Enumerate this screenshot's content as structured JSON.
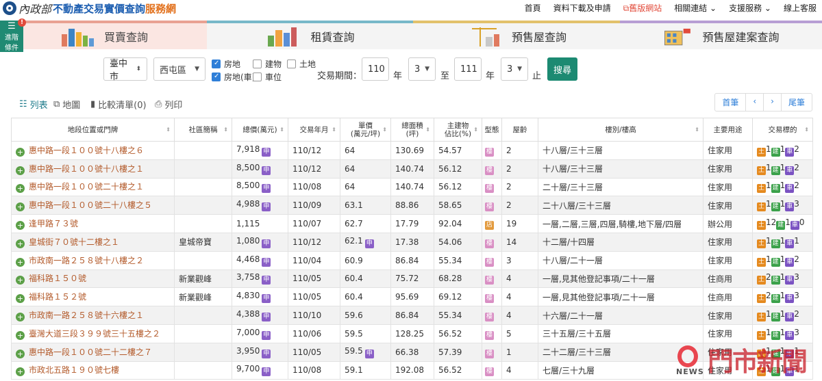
{
  "header": {
    "ministry": "內政部",
    "title_main": "不動產交易實價查詢",
    "title_sub": "服務網",
    "nav": [
      "首頁",
      "資料下載及申請",
      "舊版網站",
      "相關連結",
      "支援服務",
      "線上客服"
    ]
  },
  "advanced": {
    "label_1": "進階",
    "label_2": "條件",
    "badge": "!"
  },
  "tabs": [
    "買賣查詢",
    "租賃查詢",
    "預售屋查詢",
    "預售屋建案查詢"
  ],
  "search": {
    "city": "臺中市",
    "district": "西屯區",
    "checks": [
      {
        "label": "房地",
        "checked": true
      },
      {
        "label": "建物",
        "checked": false
      },
      {
        "label": "土地",
        "checked": false
      },
      {
        "label": "房地(車)",
        "checked": true
      },
      {
        "label": "車位",
        "checked": false
      }
    ],
    "period_label": "交易期間：",
    "from_year": "110",
    "from_month": "3",
    "to_label": "至",
    "to_year": "111",
    "to_month": "3",
    "year_unit": "年",
    "end_label": "止",
    "button": "搜尋"
  },
  "toolbar": {
    "list": "列表",
    "map": "地圖",
    "compare": "比較清單(0)",
    "print": "列印",
    "pager": [
      "首筆",
      "‹",
      "›",
      "尾筆"
    ]
  },
  "columns": [
    "地段位置或門牌",
    "社區簡稱",
    "總價(萬元)",
    "交易年月",
    "單價\n(萬元/坪)",
    "總面積\n(坪)",
    "主建物\n佔比(%)",
    "型態",
    "屋齡",
    "樓別/樓高",
    "主要用途",
    "交易標的"
  ],
  "rows": [
    {
      "addr": "惠中路一段１００號十八樓之６",
      "community": "",
      "price": "7,918",
      "price_flag": true,
      "date": "110/12",
      "unit": "64",
      "unit_flag": false,
      "area": "130.69",
      "ratio": "54.57",
      "type": "樓",
      "age": "2",
      "floor": "十八層/三十三層",
      "use": "住家用",
      "t": [
        "1",
        "1",
        "2"
      ]
    },
    {
      "addr": "惠中路一段１００號十八樓之１",
      "community": "",
      "price": "8,500",
      "price_flag": true,
      "date": "110/12",
      "unit": "64",
      "unit_flag": false,
      "area": "140.74",
      "ratio": "56.12",
      "type": "樓",
      "age": "2",
      "floor": "十八層/三十三層",
      "use": "住家用",
      "t": [
        "1",
        "1",
        "2"
      ]
    },
    {
      "addr": "惠中路一段１００號二十樓之１",
      "community": "",
      "price": "8,500",
      "price_flag": true,
      "date": "110/08",
      "unit": "64",
      "unit_flag": false,
      "area": "140.74",
      "ratio": "56.12",
      "type": "樓",
      "age": "2",
      "floor": "二十層/三十三層",
      "use": "住家用",
      "t": [
        "1",
        "1",
        "2"
      ]
    },
    {
      "addr": "惠中路一段１００號二十八樓之５",
      "community": "",
      "price": "4,988",
      "price_flag": true,
      "date": "110/09",
      "unit": "63.1",
      "unit_flag": false,
      "area": "88.86",
      "ratio": "58.65",
      "type": "樓",
      "age": "2",
      "floor": "二十八層/三十三層",
      "use": "住家用",
      "t": [
        "1",
        "1",
        "3"
      ]
    },
    {
      "addr": "逢甲路７３號",
      "community": "",
      "price": "1,115",
      "price_flag": false,
      "date": "110/07",
      "unit": "62.7",
      "unit_flag": false,
      "area": "17.79",
      "ratio": "92.04",
      "type": "店",
      "age": "19",
      "floor": "一層,二層,三層,四層,騎樓,地下層/四層",
      "use": "辦公用",
      "t": [
        "12",
        "1",
        "0"
      ]
    },
    {
      "addr": "皇城街７０號十二樓之１",
      "community": "皇城帝寶",
      "price": "1,080",
      "price_flag": true,
      "date": "110/12",
      "unit": "62.1",
      "unit_flag": true,
      "area": "17.38",
      "ratio": "54.06",
      "type": "樓",
      "age": "14",
      "floor": "十二層/十四層",
      "use": "住家用",
      "t": [
        "1",
        "1",
        "1"
      ]
    },
    {
      "addr": "市政南一路２５８號十八樓之２",
      "community": "",
      "price": "4,468",
      "price_flag": true,
      "date": "110/04",
      "unit": "60.9",
      "unit_flag": false,
      "area": "86.84",
      "ratio": "55.34",
      "type": "樓",
      "age": "3",
      "floor": "十八層/二十一層",
      "use": "住家用",
      "t": [
        "1",
        "1",
        "2"
      ]
    },
    {
      "addr": "福科路１５０號",
      "community": "新業觀峰",
      "price": "3,758",
      "price_flag": true,
      "date": "110/05",
      "unit": "60.4",
      "unit_flag": false,
      "area": "75.72",
      "ratio": "68.28",
      "type": "樓",
      "age": "4",
      "floor": "一層,見其他登記事項/二十一層",
      "use": "住商用",
      "t": [
        "2",
        "1",
        "3"
      ]
    },
    {
      "addr": "福科路１５２號",
      "community": "新業觀峰",
      "price": "4,830",
      "price_flag": true,
      "date": "110/05",
      "unit": "60.4",
      "unit_flag": false,
      "area": "95.69",
      "ratio": "69.12",
      "type": "樓",
      "age": "4",
      "floor": "一層,見其他登記事項/二十一層",
      "use": "住商用",
      "t": [
        "2",
        "1",
        "3"
      ]
    },
    {
      "addr": "市政南一路２５８號十六樓之１",
      "community": "",
      "price": "4,388",
      "price_flag": true,
      "date": "110/10",
      "unit": "59.6",
      "unit_flag": false,
      "area": "86.84",
      "ratio": "55.34",
      "type": "樓",
      "age": "4",
      "floor": "十六層/二十一層",
      "use": "住家用",
      "t": [
        "1",
        "1",
        "2"
      ]
    },
    {
      "addr": "臺灣大道三段３９９號三十五樓之２",
      "community": "",
      "price": "7,000",
      "price_flag": true,
      "date": "110/06",
      "unit": "59.5",
      "unit_flag": false,
      "area": "128.25",
      "ratio": "56.52",
      "type": "樓",
      "age": "5",
      "floor": "三十五層/三十五層",
      "use": "住家用",
      "t": [
        "1",
        "1",
        "3"
      ]
    },
    {
      "addr": "惠中路一段１００號二十二樓之７",
      "community": "",
      "price": "3,950",
      "price_flag": true,
      "date": "110/05",
      "unit": "59.5",
      "unit_flag": true,
      "area": "66.38",
      "ratio": "57.39",
      "type": "樓",
      "age": "1",
      "floor": "二十二層/三十三層",
      "use": "住家用",
      "t": [
        "1",
        "1",
        "1"
      ]
    },
    {
      "addr": "市政北五路１９０號七樓",
      "community": "",
      "price": "9,700",
      "price_flag": true,
      "date": "110/08",
      "unit": "59.1",
      "unit_flag": false,
      "area": "192.08",
      "ratio": "56.52",
      "type": "樓",
      "age": "4",
      "floor": "七層/三十九層",
      "use": "住家用",
      "t": [
        "1",
        "1",
        "1"
      ]
    }
  ],
  "tags": {
    "shen": "申",
    "tu": "土",
    "jian": "建",
    "che": "車"
  },
  "watermark": {
    "news": "NEWS",
    "text": "門市新聞"
  },
  "colors": {
    "accent": "#1c8a72",
    "address": "#b35a2a",
    "shen": "#8a5fc7",
    "land": "#e58a1f",
    "building": "#3ba14a",
    "parking": "#7b53c2"
  }
}
